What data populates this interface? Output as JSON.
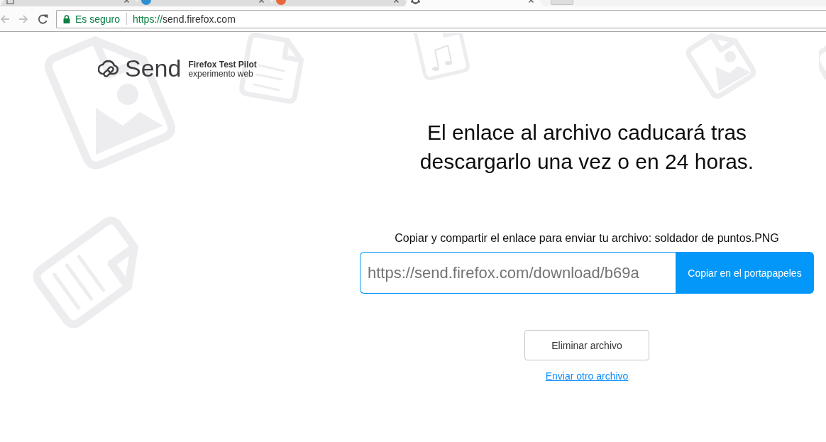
{
  "browser": {
    "tabs": [
      {
        "kind": "document",
        "color": "#6a6a6a",
        "selected": false
      },
      {
        "kind": "disc",
        "color": "#2e8fd1",
        "selected": false
      },
      {
        "kind": "disc",
        "color": "#e8683a",
        "selected": false
      },
      {
        "kind": "gear",
        "color": "#555555",
        "selected": true
      }
    ],
    "nav_buttons": [
      {
        "kind": "back",
        "disabled": true
      },
      {
        "kind": "forward",
        "disabled": true
      },
      {
        "kind": "reload",
        "disabled": false
      }
    ],
    "address_bar": {
      "security_label": "Es seguro",
      "url_scheme": "https://",
      "url_host": "send.firefox.com"
    }
  },
  "header": {
    "logo_text": "Send",
    "badge_title": "Firefox Test Pilot",
    "badge_subtitle": "experimento web"
  },
  "main": {
    "heading": "El enlace al archivo caducará tras descargarlo una vez o en 24 horas.",
    "share_label": "Copiar y compartir el enlace para enviar tu archivo: soldador de puntos.PNG",
    "link_field": {
      "value": "https://send.firefox.com/download/b69a"
    },
    "copy_button": "Copiar en el portapapeles",
    "delete_button": "Eliminar archivo",
    "send_another_link": "Enviar otro archivo"
  }
}
